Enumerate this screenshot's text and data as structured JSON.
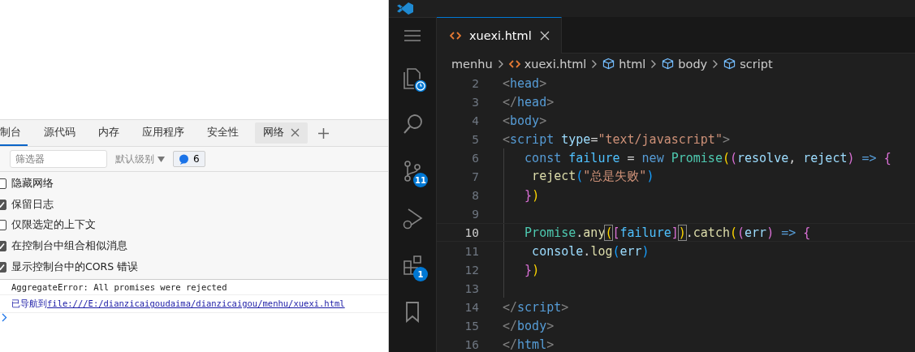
{
  "devtools": {
    "tabs": [
      {
        "label": "制台",
        "selected": true,
        "closable": false
      },
      {
        "label": "源代码",
        "selected": false,
        "closable": false
      },
      {
        "label": "内存",
        "selected": false,
        "closable": false
      },
      {
        "label": "应用程序",
        "selected": false,
        "closable": false
      },
      {
        "label": "安全性",
        "selected": false,
        "closable": false
      },
      {
        "label": "网络",
        "selected": false,
        "closable": true
      }
    ],
    "toolbar": {
      "filter": {
        "placeholder": "筛选器"
      },
      "level": "默认级别",
      "message_count": "6"
    },
    "options": [
      {
        "label": "隐藏网络",
        "checked": false
      },
      {
        "label": "保留日志",
        "checked": true
      },
      {
        "label": "仅限选定的上下文",
        "checked": false
      },
      {
        "label": "在控制台中组合相似消息",
        "checked": true
      },
      {
        "label": "显示控制台中的CORS 错误",
        "checked": true
      }
    ],
    "console": {
      "error": "AggregateError: All promises were rejected",
      "navigated": "已导航到",
      "link": "file:///E:/dianzicaigoudaima/dianzicaigou/menhu/xuexi.html"
    }
  },
  "editor": {
    "activity_badges": [
      {
        "kind": "clock"
      },
      {
        "kind": "count",
        "text": "11"
      },
      {
        "kind": "count",
        "text": "1"
      }
    ],
    "tab": {
      "label": "xuexi.html",
      "selected": true
    },
    "breadcrumb": [
      {
        "kind": "folder",
        "label": "menhu"
      },
      {
        "kind": "file",
        "label": "xuexi.html"
      },
      {
        "kind": "symbol",
        "label": "html"
      },
      {
        "kind": "symbol",
        "label": "body"
      },
      {
        "kind": "symbol",
        "label": "script"
      }
    ],
    "lines": [
      {
        "number": "2",
        "current": false,
        "guide": false,
        "tokens": [
          {
            "kind": "punct",
            "text": "<"
          },
          {
            "kind": "tag",
            "text": "head"
          },
          {
            "kind": "punct",
            "text": ">"
          }
        ]
      },
      {
        "number": "3",
        "current": false,
        "guide": false,
        "tokens": [
          {
            "kind": "punct",
            "text": "</"
          },
          {
            "kind": "tag",
            "text": "head"
          },
          {
            "kind": "punct",
            "text": ">"
          }
        ]
      },
      {
        "number": "4",
        "current": false,
        "guide": false,
        "tokens": [
          {
            "kind": "punct",
            "text": "<"
          },
          {
            "kind": "tag",
            "text": "body"
          },
          {
            "kind": "punct",
            "text": ">"
          }
        ]
      },
      {
        "number": "5",
        "current": false,
        "guide": false,
        "tokens": [
          {
            "kind": "punct",
            "text": "<"
          },
          {
            "kind": "tag",
            "text": "script"
          },
          {
            "kind": "attr",
            "text": " type"
          },
          {
            "kind": "text",
            "text": "="
          },
          {
            "kind": "string",
            "text": "\"text/javascript\""
          },
          {
            "kind": "punct",
            "text": ">"
          }
        ]
      },
      {
        "number": "6",
        "current": false,
        "guide": true,
        "tokens": [
          {
            "kind": "keyword",
            "text": "   const"
          },
          {
            "kind": "const",
            "text": " failure"
          },
          {
            "kind": "text",
            "text": " = "
          },
          {
            "kind": "keyword",
            "text": "new"
          },
          {
            "kind": "type",
            "text": " Promise"
          },
          {
            "kind": "b1",
            "text": "("
          },
          {
            "kind": "b2",
            "text": "("
          },
          {
            "kind": "param",
            "text": "resolve"
          },
          {
            "kind": "text",
            "text": ", "
          },
          {
            "kind": "param",
            "text": "reject"
          },
          {
            "kind": "b2",
            "text": ")"
          },
          {
            "kind": "keyword",
            "text": " => "
          },
          {
            "kind": "b2",
            "text": "{"
          }
        ]
      },
      {
        "number": "7",
        "current": false,
        "guide": true,
        "tokens": [
          {
            "kind": "func",
            "text": "    reject"
          },
          {
            "kind": "b3",
            "text": "("
          },
          {
            "kind": "string",
            "text": "\"总是失败\""
          },
          {
            "kind": "b3",
            "text": ")"
          }
        ]
      },
      {
        "number": "8",
        "current": false,
        "guide": true,
        "tokens": [
          {
            "kind": "b2",
            "text": "   }"
          },
          {
            "kind": "b1",
            "text": ")"
          }
        ]
      },
      {
        "number": "9",
        "current": false,
        "guide": true
      },
      {
        "number": "10",
        "current": true,
        "guide": true,
        "tokens": [
          {
            "kind": "type",
            "text": "   Promise"
          },
          {
            "kind": "text",
            "text": "."
          },
          {
            "kind": "func",
            "text": "any"
          },
          {
            "kind": "b1",
            "text": "(",
            "boxed": true
          },
          {
            "kind": "b2",
            "text": "["
          },
          {
            "kind": "const",
            "text": "failure"
          },
          {
            "kind": "b2",
            "text": "]"
          },
          {
            "kind": "b1",
            "text": ")",
            "boxed": true
          },
          {
            "kind": "text",
            "text": "."
          },
          {
            "kind": "func",
            "text": "catch"
          },
          {
            "kind": "b1",
            "text": "("
          },
          {
            "kind": "b2",
            "text": "("
          },
          {
            "kind": "param",
            "text": "err"
          },
          {
            "kind": "b2",
            "text": ")"
          },
          {
            "kind": "keyword",
            "text": " => "
          },
          {
            "kind": "b2",
            "text": "{"
          }
        ]
      },
      {
        "number": "11",
        "current": false,
        "guide": true,
        "tokens": [
          {
            "kind": "param",
            "text": "    console"
          },
          {
            "kind": "text",
            "text": "."
          },
          {
            "kind": "func",
            "text": "log"
          },
          {
            "kind": "b3",
            "text": "("
          },
          {
            "kind": "param",
            "text": "err"
          },
          {
            "kind": "b3",
            "text": ")"
          }
        ]
      },
      {
        "number": "12",
        "current": false,
        "guide": true,
        "tokens": [
          {
            "kind": "b2",
            "text": "   }"
          },
          {
            "kind": "b1",
            "text": ")"
          }
        ]
      },
      {
        "number": "13",
        "current": false,
        "guide": true
      },
      {
        "number": "14",
        "current": false,
        "guide": false,
        "tokens": [
          {
            "kind": "punct",
            "text": "</"
          },
          {
            "kind": "tag",
            "text": "script"
          },
          {
            "kind": "punct",
            "text": ">"
          }
        ]
      },
      {
        "number": "15",
        "current": false,
        "guide": false,
        "tokens": [
          {
            "kind": "punct",
            "text": "</"
          },
          {
            "kind": "tag",
            "text": "body"
          },
          {
            "kind": "punct",
            "text": ">"
          }
        ]
      },
      {
        "number": "16",
        "current": false,
        "guide": false,
        "tokens": [
          {
            "kind": "punct",
            "text": "</"
          },
          {
            "kind": "tag",
            "text": "html"
          },
          {
            "kind": "punct",
            "text": ">"
          }
        ]
      }
    ]
  }
}
